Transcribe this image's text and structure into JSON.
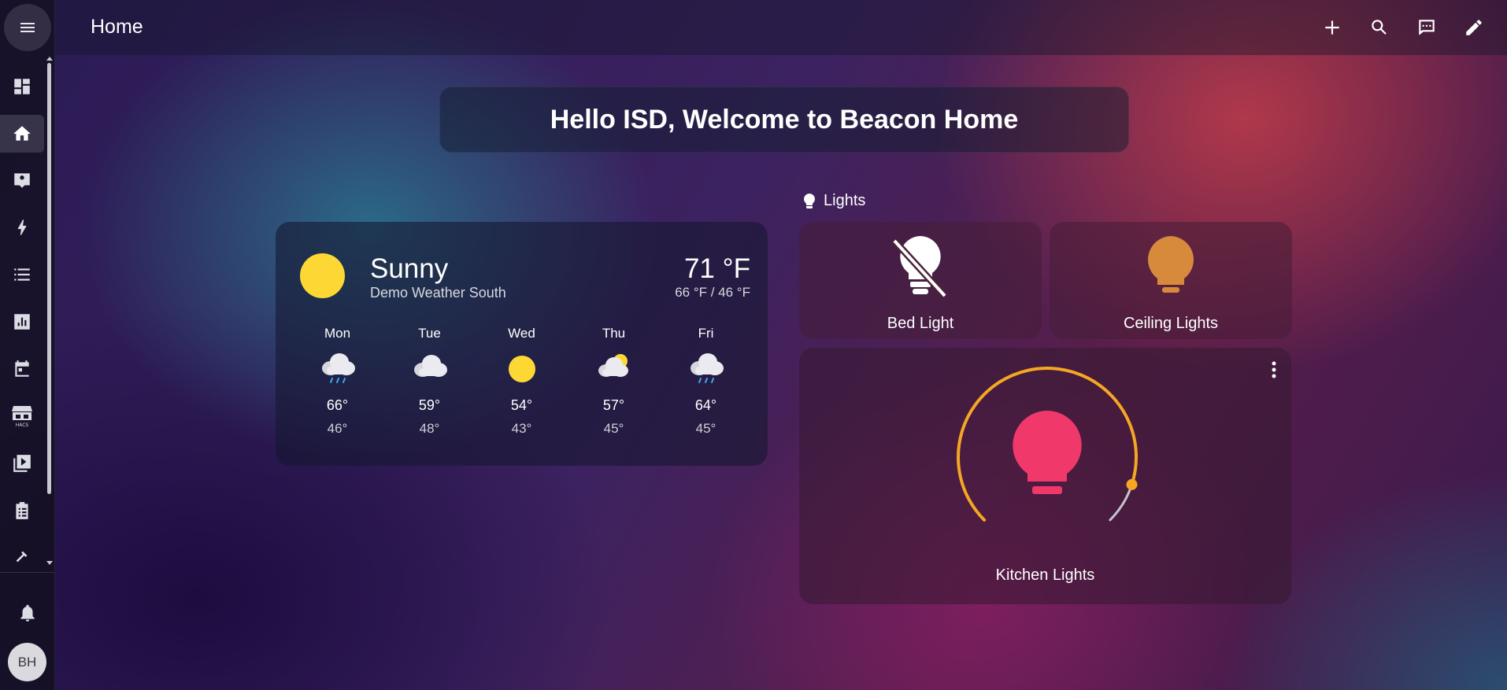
{
  "header": {
    "title": "Home"
  },
  "sidebar": {
    "items": [
      {
        "name": "overview",
        "icon": "dashboard-icon",
        "active": false
      },
      {
        "name": "home",
        "icon": "home-icon",
        "active": true
      },
      {
        "name": "contacts",
        "icon": "account-box-icon",
        "active": false
      },
      {
        "name": "energy",
        "icon": "lightning-icon",
        "active": false
      },
      {
        "name": "logbook",
        "icon": "list-icon",
        "active": false
      },
      {
        "name": "history",
        "icon": "chart-icon",
        "active": false
      },
      {
        "name": "calendar",
        "icon": "calendar-icon",
        "active": false
      },
      {
        "name": "hacs",
        "icon": "hacs-store-icon",
        "active": false
      },
      {
        "name": "media",
        "icon": "media-play-icon",
        "active": false
      },
      {
        "name": "todo",
        "icon": "clipboard-list-icon",
        "active": false
      },
      {
        "name": "developer-tools",
        "icon": "hammer-icon",
        "active": false
      }
    ],
    "user_initials": "BH"
  },
  "banner": {
    "text": "Hello ISD, Welcome to Beacon Home"
  },
  "weather": {
    "condition": "Sunny",
    "name": "Demo Weather South",
    "temperature": "71 °F",
    "high_low": "66 °F / 46 °F",
    "forecast": [
      {
        "day": "Mon",
        "icon": "rain-cloud-icon",
        "high": "66°",
        "low": "46°"
      },
      {
        "day": "Tue",
        "icon": "cloud-icon",
        "high": "59°",
        "low": "48°"
      },
      {
        "day": "Wed",
        "icon": "sun-icon",
        "high": "54°",
        "low": "43°"
      },
      {
        "day": "Thu",
        "icon": "partly-cloudy-icon",
        "high": "57°",
        "low": "45°"
      },
      {
        "day": "Fri",
        "icon": "rain-cloud-icon",
        "high": "64°",
        "low": "45°"
      }
    ]
  },
  "lights": {
    "heading": "Lights",
    "tiles": [
      {
        "name": "Bed Light",
        "state": "off",
        "color": "#ffffff"
      },
      {
        "name": "Ceiling Lights",
        "state": "on",
        "color": "#d88a3c"
      }
    ],
    "kitchen": {
      "name": "Kitchen Lights",
      "color": "#f0396a",
      "arc_color": "#f5a623",
      "brightness": 0.9
    }
  }
}
